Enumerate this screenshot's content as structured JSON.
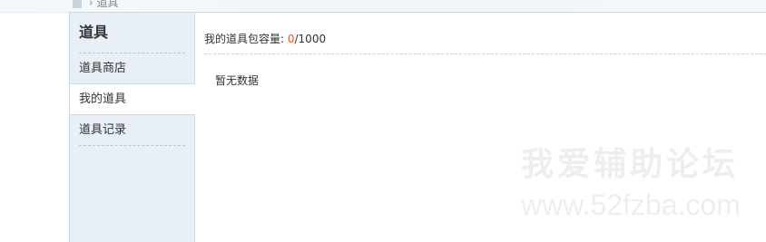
{
  "breadcrumb": {
    "current": "道具"
  },
  "sidebar": {
    "title": "道具",
    "items": [
      {
        "label": "道具商店"
      },
      {
        "label": "我的道具",
        "active": true
      },
      {
        "label": "道具记录"
      }
    ]
  },
  "main": {
    "capacity_label": "我的道具包容量: ",
    "capacity_used": "0",
    "capacity_total": "/1000",
    "empty_text": "暂无数据"
  },
  "watermark": {
    "line1": "我爱辅助论坛",
    "line2": "www.52fzba.com"
  },
  "colors": {
    "accent": "#e4572e",
    "sidebar_bg": "#e8eff6",
    "border": "#cdd8e2"
  }
}
